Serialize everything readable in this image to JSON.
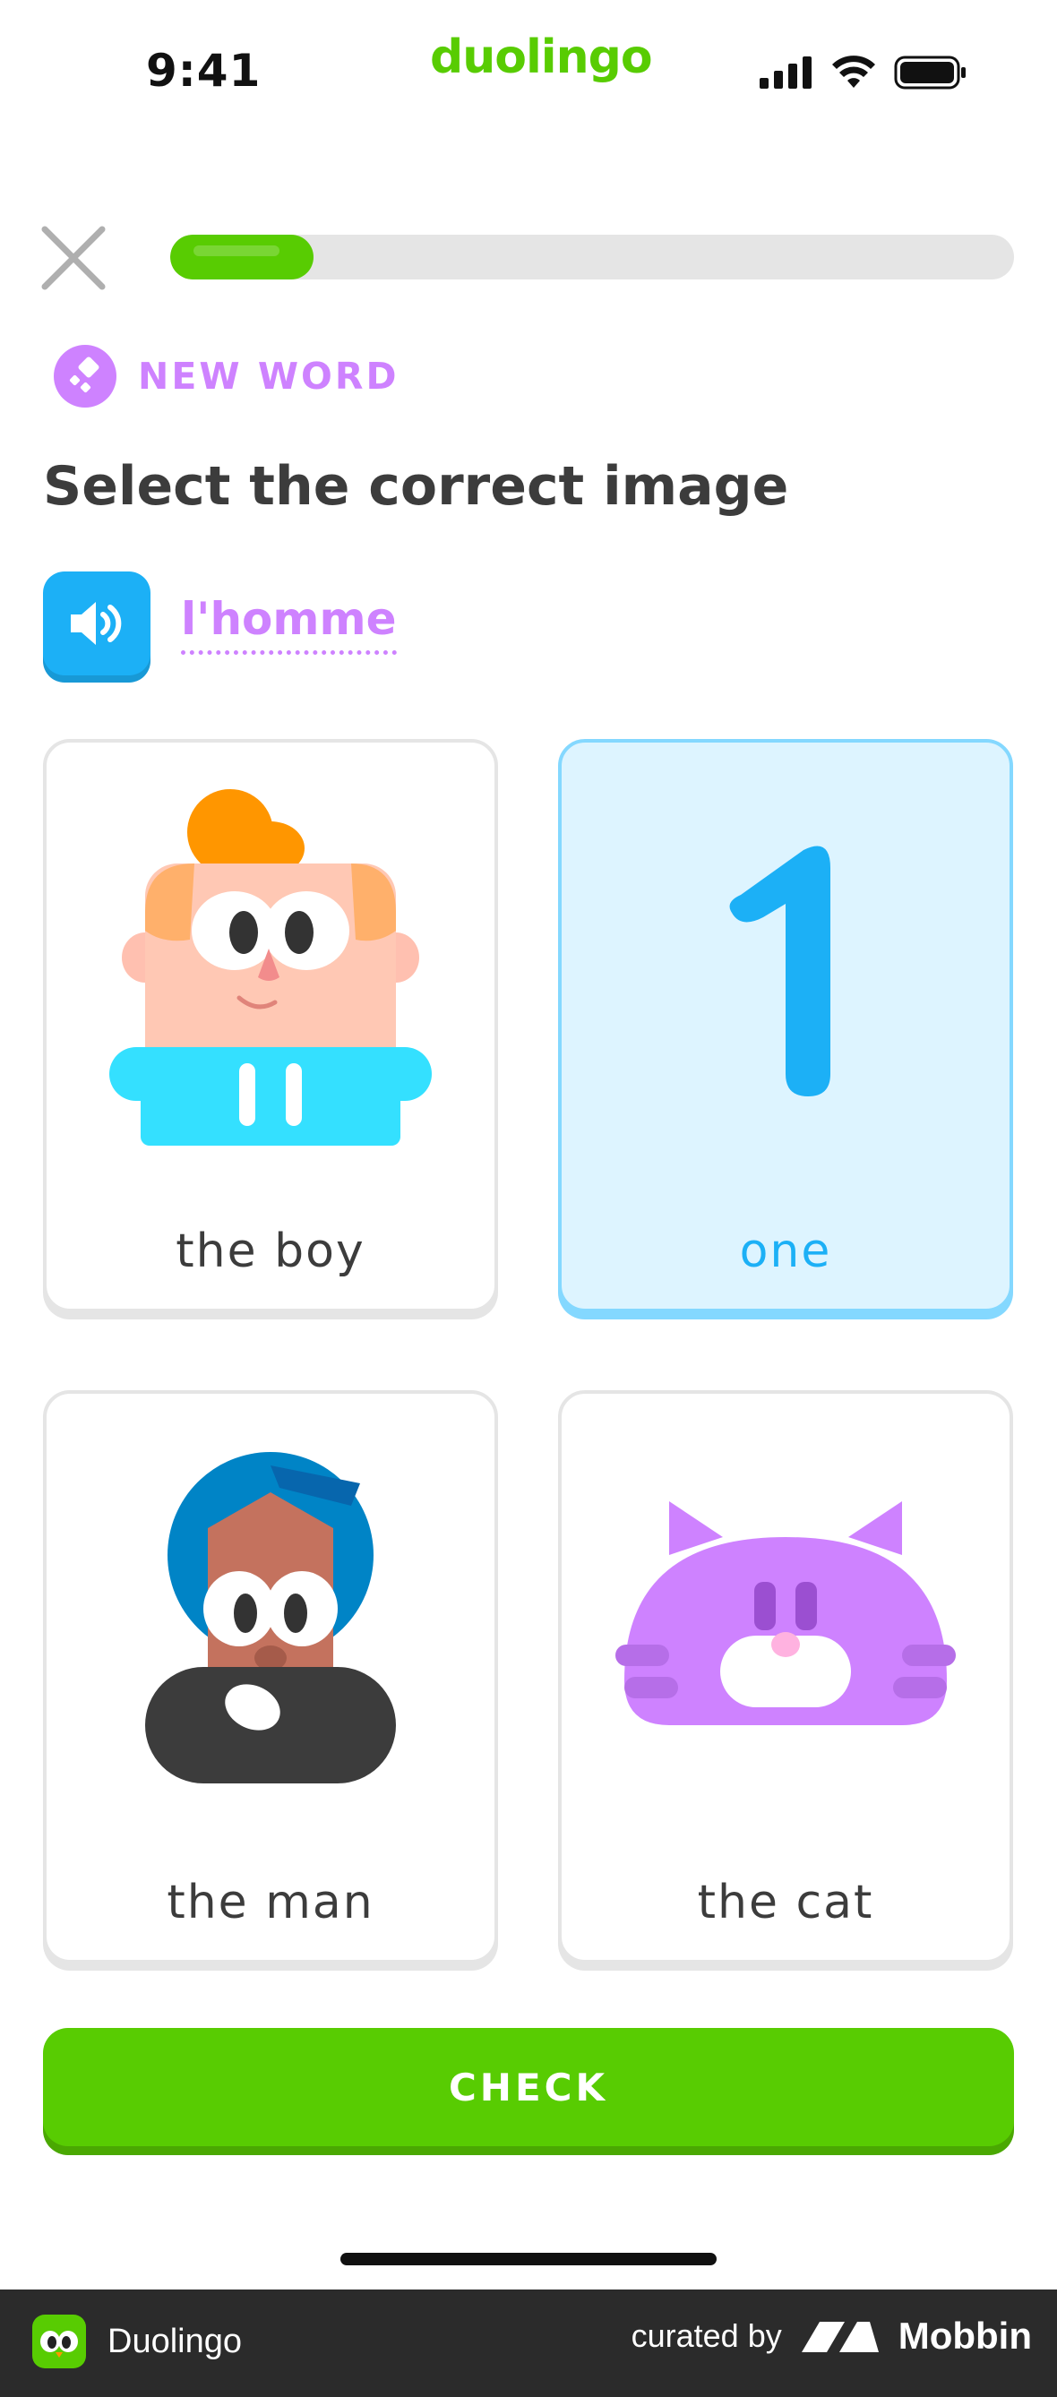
{
  "status_bar": {
    "time": "9:41",
    "brand": "duolingo"
  },
  "lesson": {
    "progress_fraction": 0.17
  },
  "badge": {
    "label": "NEW WORD"
  },
  "prompt": {
    "title": "Select the correct image",
    "word": "l'homme"
  },
  "choices": [
    {
      "label": "the boy",
      "selected": false
    },
    {
      "label": "one",
      "selected": true
    },
    {
      "label": "the man",
      "selected": false
    },
    {
      "label": "the cat",
      "selected": false
    }
  ],
  "actions": {
    "check_label": "CHECK"
  },
  "footer": {
    "app_name": "Duolingo",
    "curated_by": "curated by",
    "brand": "Mobbin"
  },
  "colors": {
    "primary_green": "#58cc02",
    "accent_purple": "#ce82ff",
    "accent_blue": "#1cb0f6",
    "selected_bg": "#ddf4ff"
  }
}
